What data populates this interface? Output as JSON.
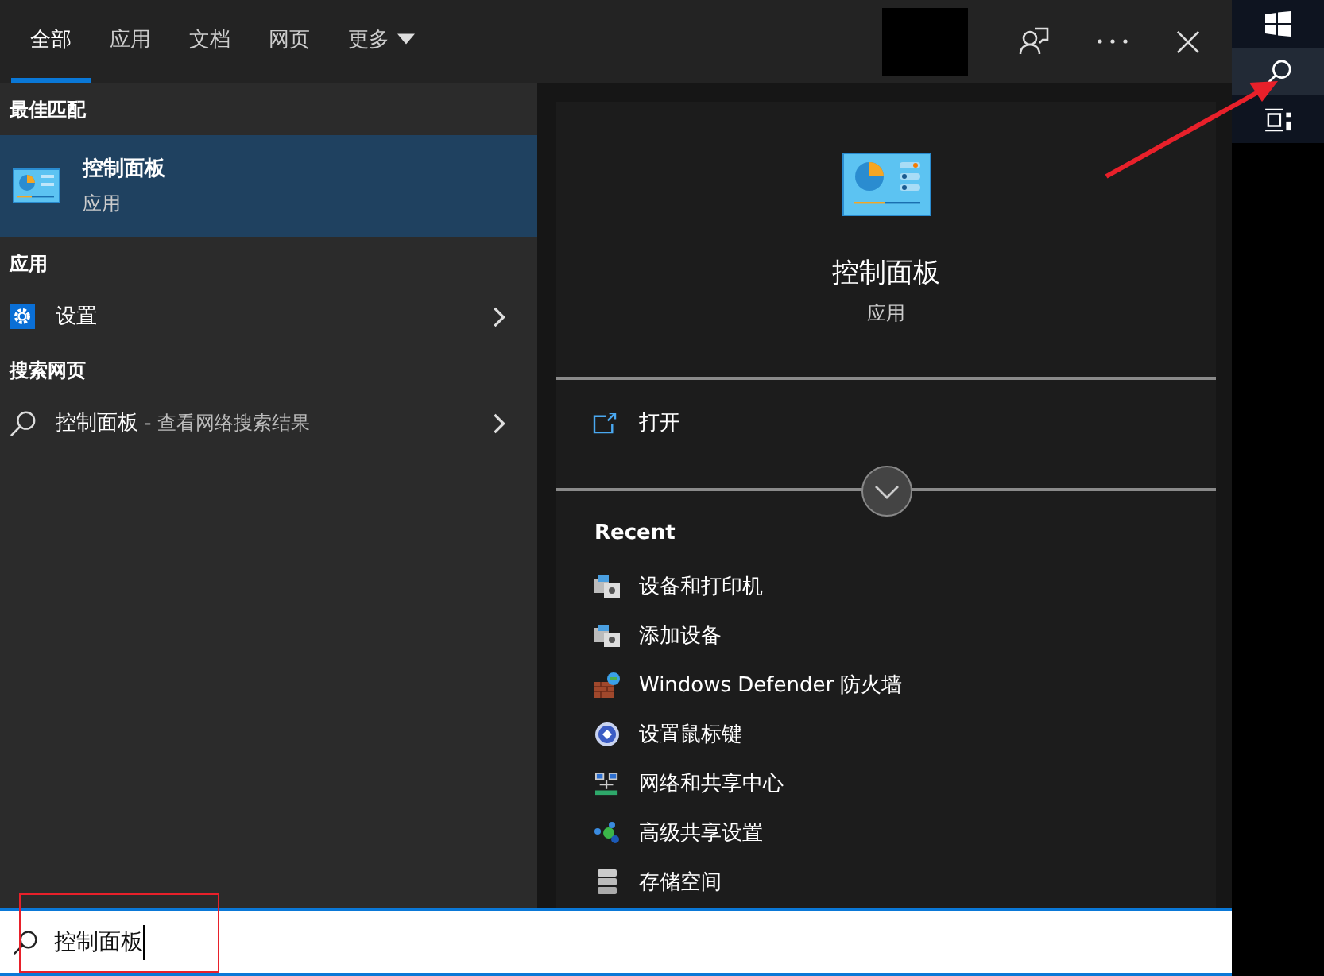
{
  "tabs": [
    {
      "label": "全部",
      "selected": true
    },
    {
      "label": "应用",
      "selected": false
    },
    {
      "label": "文档",
      "selected": false
    },
    {
      "label": "网页",
      "selected": false
    },
    {
      "label": "更多",
      "selected": false,
      "dropdown": true
    }
  ],
  "results": [
    {
      "heading": "最佳匹配",
      "items": [
        {
          "kind": "best",
          "title": "控制面板",
          "subtitle": "应用",
          "selected": true
        }
      ]
    },
    {
      "heading": "应用",
      "items": [
        {
          "kind": "settings",
          "title": "设置",
          "selected": false
        }
      ]
    },
    {
      "heading": "搜索网页",
      "items": [
        {
          "kind": "web",
          "title": "控制面板",
          "suffix": " - 查看网络搜索结果",
          "selected": false
        }
      ]
    }
  ],
  "detail": {
    "title": "控制面板",
    "subtitle": "应用",
    "actions": [
      {
        "label": "打开"
      }
    ],
    "recent_heading": "Recent",
    "recent": [
      {
        "kind": "devices",
        "label": "设备和打印机"
      },
      {
        "kind": "devices",
        "label": "添加设备"
      },
      {
        "kind": "firewall",
        "label": "Windows Defender 防火墙"
      },
      {
        "kind": "mouse",
        "label": "设置鼠标键"
      },
      {
        "kind": "network",
        "label": "网络和共享中心"
      },
      {
        "kind": "sharing",
        "label": "高级共享设置"
      },
      {
        "kind": "storage",
        "label": "存储空间"
      }
    ]
  },
  "search": {
    "value": "控制面板"
  }
}
